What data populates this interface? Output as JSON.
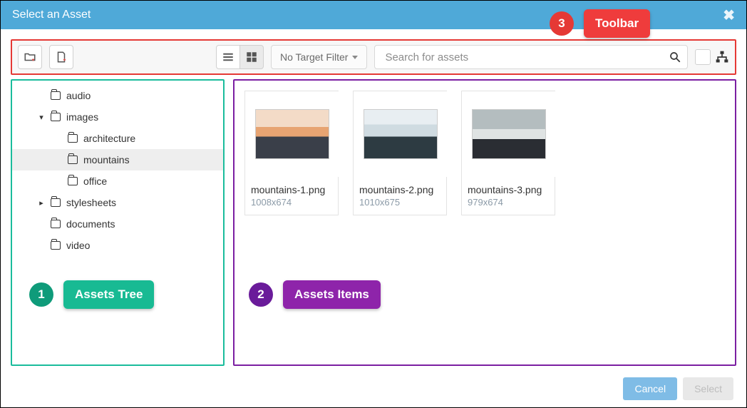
{
  "header": {
    "title": "Select an Asset"
  },
  "toolbar": {
    "filter_label": "No Target Filter",
    "search_placeholder": "Search for assets"
  },
  "tree": {
    "items": [
      {
        "label": "audio",
        "depth": 0,
        "caret": "none",
        "selected": false
      },
      {
        "label": "images",
        "depth": 0,
        "caret": "down",
        "selected": false
      },
      {
        "label": "architecture",
        "depth": 1,
        "caret": "none",
        "selected": false
      },
      {
        "label": "mountains",
        "depth": 1,
        "caret": "none",
        "selected": true
      },
      {
        "label": "office",
        "depth": 1,
        "caret": "none",
        "selected": false
      },
      {
        "label": "stylesheets",
        "depth": 0,
        "caret": "right",
        "selected": false
      },
      {
        "label": "documents",
        "depth": 0,
        "caret": "none",
        "selected": false
      },
      {
        "label": "video",
        "depth": 0,
        "caret": "none",
        "selected": false
      }
    ]
  },
  "assets": [
    {
      "name": "mountains-1.png",
      "dim": "1008x674",
      "style": "sunset"
    },
    {
      "name": "mountains-2.png",
      "dim": "1010x675",
      "style": "clouds"
    },
    {
      "name": "mountains-3.png",
      "dim": "979x674",
      "style": "snow"
    }
  ],
  "footer": {
    "cancel": "Cancel",
    "select": "Select"
  },
  "callouts": {
    "one": {
      "num": "1",
      "label": "Assets Tree"
    },
    "two": {
      "num": "2",
      "label": "Assets Items"
    },
    "three": {
      "num": "3",
      "label": "Toolbar"
    }
  }
}
